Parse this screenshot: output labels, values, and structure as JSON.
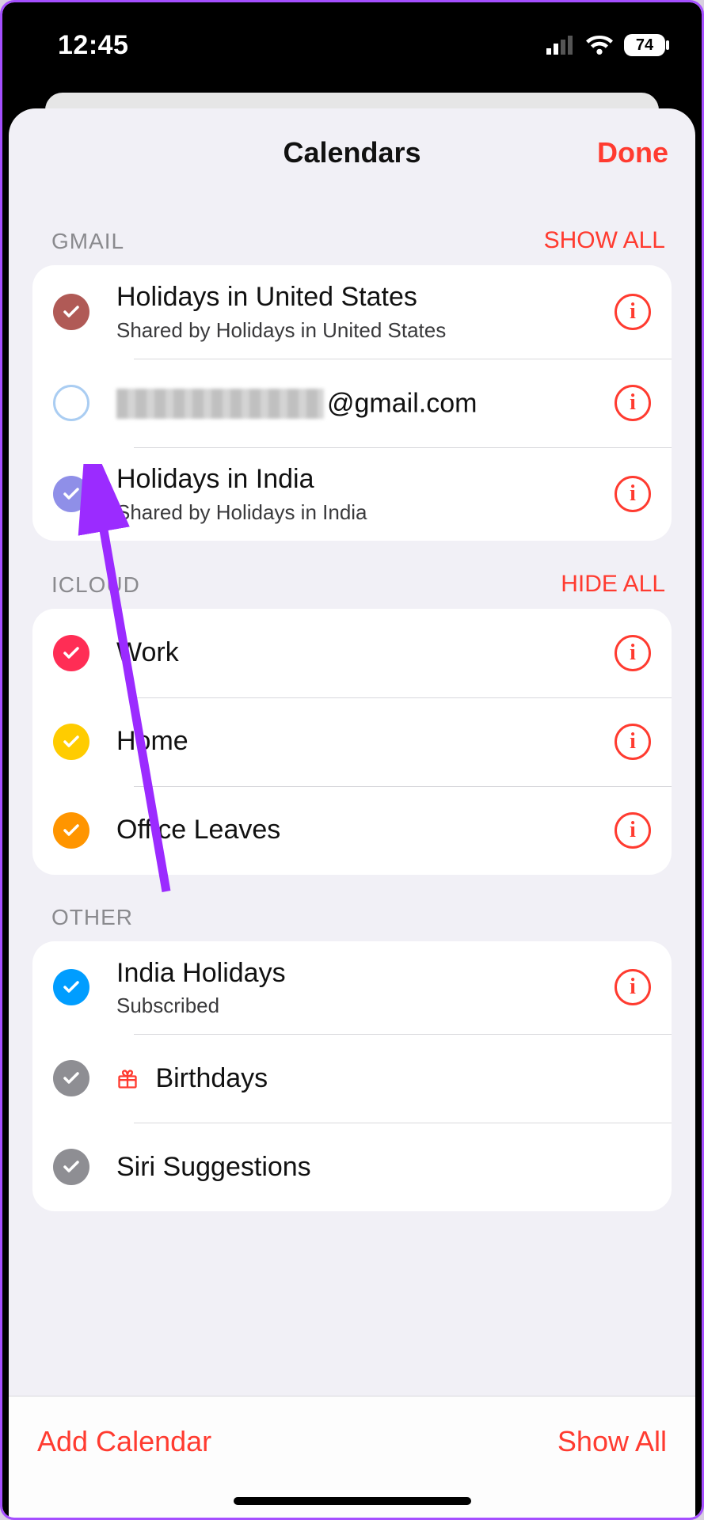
{
  "status": {
    "time": "12:45",
    "battery": "74"
  },
  "header": {
    "title": "Calendars",
    "done": "Done"
  },
  "sections": {
    "gmail": {
      "name": "GMAIL",
      "action": "SHOW ALL",
      "rows": {
        "us": {
          "title": "Holidays in United States",
          "sub": "Shared by Holidays in United States"
        },
        "email": {
          "domain": "@gmail.com"
        },
        "india": {
          "title": "Holidays in India",
          "sub": "Shared by Holidays in India"
        }
      }
    },
    "icloud": {
      "name": "ICLOUD",
      "action": "HIDE ALL",
      "rows": {
        "work": {
          "title": "Work"
        },
        "home": {
          "title": "Home"
        },
        "office": {
          "title": "Office Leaves"
        }
      }
    },
    "other": {
      "name": "OTHER",
      "rows": {
        "indiahol": {
          "title": "India Holidays",
          "sub": "Subscribed"
        },
        "bday": {
          "title": "Birthdays"
        },
        "siri": {
          "title": "Siri Suggestions"
        }
      }
    }
  },
  "bottom": {
    "add": "Add Calendar",
    "showall": "Show All"
  },
  "colors": {
    "gmail_us": "#b05a56",
    "gmail_india": "#8f8fe8",
    "work": "#ff2d55",
    "home": "#ffcc00",
    "office": "#ff9500",
    "other": "#009dff",
    "grey": "#8e8e93"
  }
}
